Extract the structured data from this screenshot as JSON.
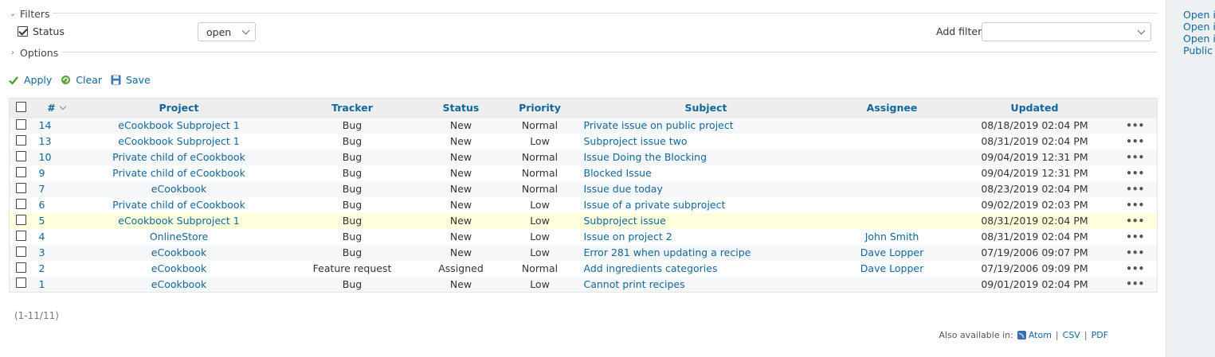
{
  "filters": {
    "legend": "Filters",
    "status_label": "Status",
    "status_operator": "open",
    "add_filter_label": "Add filter",
    "add_filter_value": ""
  },
  "options": {
    "legend": "Options"
  },
  "actions": {
    "apply": "Apply",
    "clear": "Clear",
    "save": "Save"
  },
  "table": {
    "headers": {
      "id": "#",
      "project": "Project",
      "tracker": "Tracker",
      "status": "Status",
      "priority": "Priority",
      "subject": "Subject",
      "assignee": "Assignee",
      "updated": "Updated"
    },
    "rows": [
      {
        "id": "14",
        "project": "eCookbook Subproject 1",
        "tracker": "Bug",
        "status": "New",
        "priority": "Normal",
        "subject": "Private issue on public project",
        "assignee": "",
        "updated": "08/18/2019 02:04 PM",
        "menu": "•••"
      },
      {
        "id": "13",
        "project": "eCookbook Subproject 1",
        "tracker": "Bug",
        "status": "New",
        "priority": "Low",
        "subject": "Subproject issue two",
        "assignee": "",
        "updated": "08/31/2019 02:04 PM",
        "menu": "•••"
      },
      {
        "id": "10",
        "project": "Private child of eCookbook",
        "tracker": "Bug",
        "status": "New",
        "priority": "Normal",
        "subject": "Issue Doing the Blocking",
        "assignee": "",
        "updated": "09/04/2019 12:31 PM",
        "menu": "•••"
      },
      {
        "id": "9",
        "project": "Private child of eCookbook",
        "tracker": "Bug",
        "status": "New",
        "priority": "Normal",
        "subject": "Blocked Issue",
        "assignee": "",
        "updated": "09/04/2019 12:31 PM",
        "menu": "•••"
      },
      {
        "id": "7",
        "project": "eCookbook",
        "tracker": "Bug",
        "status": "New",
        "priority": "Normal",
        "subject": "Issue due today",
        "assignee": "",
        "updated": "08/23/2019 02:04 PM",
        "menu": "•••"
      },
      {
        "id": "6",
        "project": "Private child of eCookbook",
        "tracker": "Bug",
        "status": "New",
        "priority": "Low",
        "subject": "Issue of a private subproject",
        "assignee": "",
        "updated": "09/02/2019 02:03 PM",
        "menu": "•••"
      },
      {
        "id": "5",
        "project": "eCookbook Subproject 1",
        "tracker": "Bug",
        "status": "New",
        "priority": "Low",
        "subject": "Subproject issue",
        "assignee": "",
        "updated": "08/31/2019 02:04 PM",
        "menu": "•••"
      },
      {
        "id": "4",
        "project": "OnlineStore",
        "tracker": "Bug",
        "status": "New",
        "priority": "Low",
        "subject": "Issue on project 2",
        "assignee": "John Smith",
        "updated": "08/31/2019 02:04 PM",
        "menu": "•••"
      },
      {
        "id": "3",
        "project": "eCookbook",
        "tracker": "Bug",
        "status": "New",
        "priority": "Low",
        "subject": "Error 281 when updating a recipe",
        "assignee": "Dave Lopper",
        "updated": "07/19/2006 09:07 PM",
        "menu": "•••"
      },
      {
        "id": "2",
        "project": "eCookbook",
        "tracker": "Feature request",
        "status": "Assigned",
        "priority": "Normal",
        "subject": "Add ingredients categories",
        "assignee": "Dave Lopper",
        "updated": "07/19/2006 09:09 PM",
        "menu": "•••"
      },
      {
        "id": "1",
        "project": "eCookbook",
        "tracker": "Bug",
        "status": "New",
        "priority": "Low",
        "subject": "Cannot print recipes",
        "assignee": "",
        "updated": "09/01/2019 02:04 PM",
        "menu": "•••"
      }
    ]
  },
  "pagination": "(1-11/11)",
  "formats": {
    "label": "Also available in:",
    "atom": "Atom",
    "csv": "CSV",
    "pdf": "PDF"
  },
  "sidebar": {
    "links": [
      "Open i",
      "Open i",
      "Open i",
      "Public"
    ]
  },
  "colors": {
    "link": "#116699",
    "header_bg": "#eeeeee",
    "highlight_row": "#ffffdd",
    "sidebar_bg": "#eef1f4"
  }
}
